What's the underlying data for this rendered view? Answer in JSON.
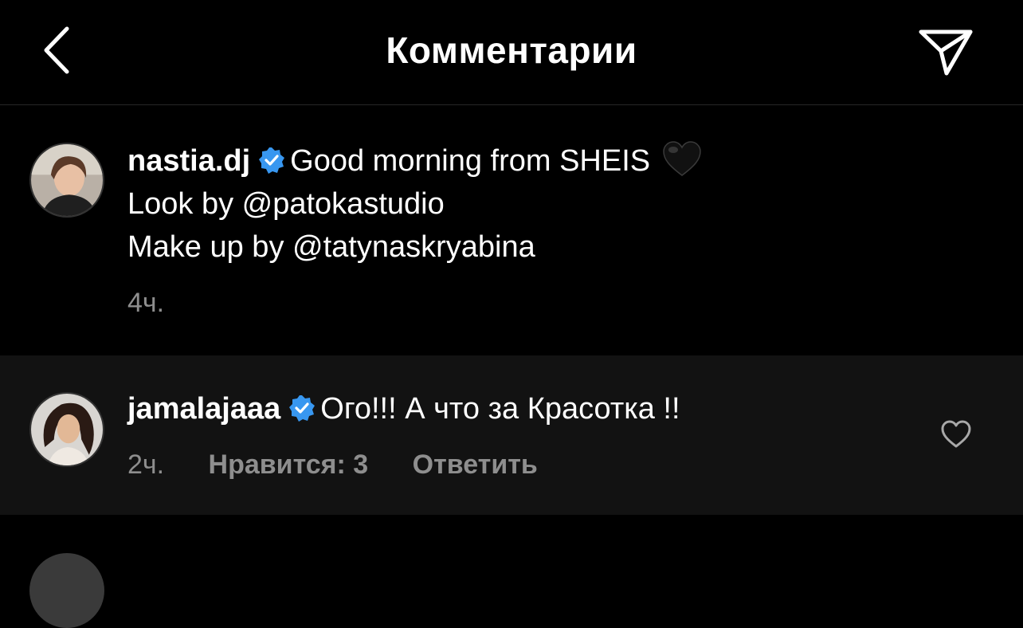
{
  "header": {
    "title": "Комментарии",
    "back_icon": "chevron-left-icon",
    "send_icon": "paper-plane-icon"
  },
  "caption": {
    "username": "nastia.dj",
    "verified": true,
    "text_line_1": "Good morning from SHEIS",
    "emoji": "black-heart",
    "text_line_2": "Look by @patokastudio",
    "text_line_3": "Make up by @tatynaskryabina",
    "time": "4ч."
  },
  "comment": {
    "username": "jamalajaaa",
    "verified": true,
    "text": "Ого!!! А что за Красотка !!",
    "time": "2ч.",
    "likes": "Нравится: 3",
    "reply": "Ответить"
  },
  "colors": {
    "background": "#000000",
    "comment_background": "#121212",
    "secondary_text": "#8e8e8e",
    "verified_blue": "#3897f0",
    "divider": "#262626"
  }
}
